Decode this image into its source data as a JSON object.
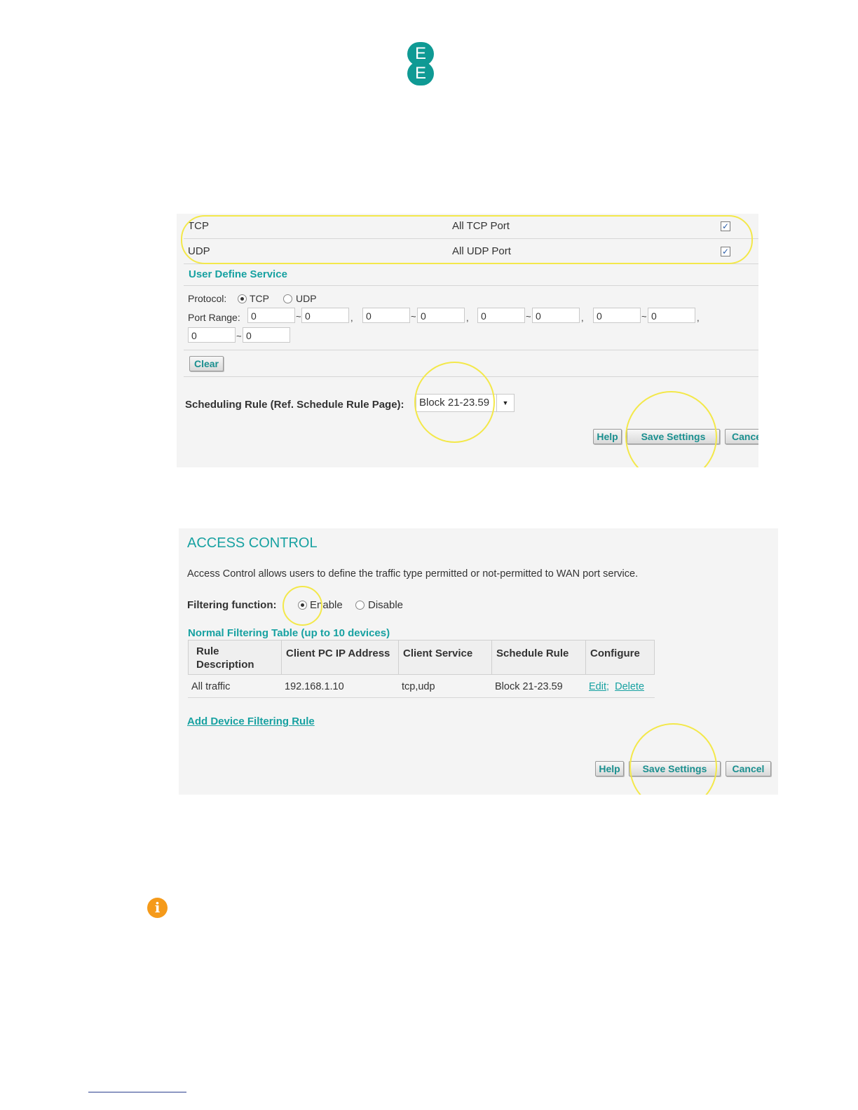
{
  "logo": {
    "letter_top": "E",
    "letter_bottom": "E",
    "color": "#0f9a94"
  },
  "services_panel": {
    "rows": [
      {
        "protocol": "TCP",
        "description": "All TCP Port",
        "checked": true
      },
      {
        "protocol": "UDP",
        "description": "All UDP Port",
        "checked": true
      }
    ],
    "user_define_title": "User Define Service",
    "protocol_label": "Protocol:",
    "protocol_options": [
      "TCP",
      "UDP"
    ],
    "protocol_selected": "TCP",
    "port_range_label": "Port Range:",
    "port_values": [
      "0",
      "0",
      "0",
      "0",
      "0",
      "0",
      "0",
      "0",
      "0",
      "0"
    ],
    "range_sep": "~",
    "comma": ",",
    "clear_button": "Clear",
    "scheduling_label": "Scheduling Rule (Ref. Schedule Rule Page):",
    "scheduling_value": "Block 21-23.59",
    "help_button": "Help",
    "save_button": "Save Settings",
    "cancel_button": "Cance"
  },
  "access_control": {
    "title": "ACCESS CONTROL",
    "description": "Access Control allows users to define the traffic type permitted or not-permitted to WAN port service.",
    "filtering_label": "Filtering function:",
    "enable_label": "Enable",
    "disable_label": "Disable",
    "filtering_selected": "Enable",
    "table_title": "Normal Filtering Table (up to 10 devices)",
    "columns": [
      "Rule Description",
      "Client PC IP Address",
      "Client Service",
      "Schedule Rule",
      "Configure"
    ],
    "rows": [
      {
        "rule_description": "All traffic",
        "ip": "192.168.1.10",
        "service": "tcp,udp",
        "schedule": "Block 21-23.59",
        "edit": "Edit",
        "sep": ";",
        "delete": "Delete"
      }
    ],
    "add_rule_link": "Add Device Filtering Rule",
    "help_button": "Help",
    "save_button": "Save Settings",
    "cancel_button": "Cancel"
  },
  "colors": {
    "teal": "#17a1a1",
    "highlight": "#f3e84a",
    "info": "#f59a1a"
  },
  "info_icon": {
    "glyph": "i",
    "name": "info-icon"
  }
}
